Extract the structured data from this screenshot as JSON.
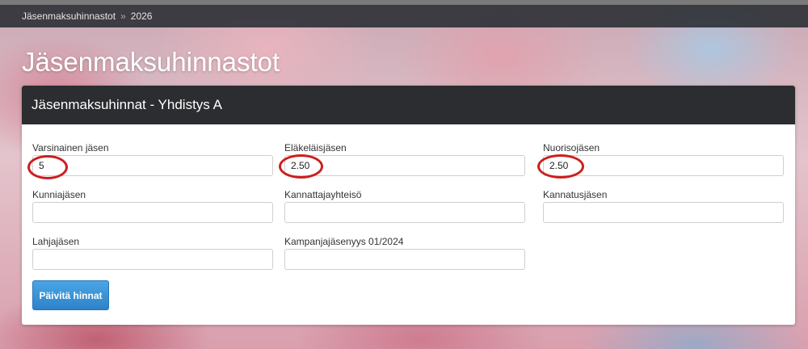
{
  "breadcrumb": {
    "items": [
      "Jäsenmaksuhinnastot",
      "2026"
    ],
    "separator": "»"
  },
  "page_title": "Jäsenmaksuhinnastot",
  "panel": {
    "title": "Jäsenmaksuhinnat - Yhdistys A",
    "fields": [
      {
        "label": "Varsinainen jäsen",
        "value": "5"
      },
      {
        "label": "Eläkeläisjäsen",
        "value": "2.50"
      },
      {
        "label": "Nuorisojäsen",
        "value": "2.50"
      },
      {
        "label": "Kunniajäsen",
        "value": ""
      },
      {
        "label": "Kannattajayhteisö",
        "value": ""
      },
      {
        "label": "Kannatusjäsen",
        "value": ""
      },
      {
        "label": "Lahjajäsen",
        "value": ""
      },
      {
        "label": "Kampanjajäsenyys 01/2024",
        "value": ""
      }
    ],
    "submit_label": "Päivitä hinnat"
  },
  "colors": {
    "header_bg": "#2b2d30",
    "button_bg": "#3a93d6",
    "highlight_circle": "#cc1f1f"
  }
}
